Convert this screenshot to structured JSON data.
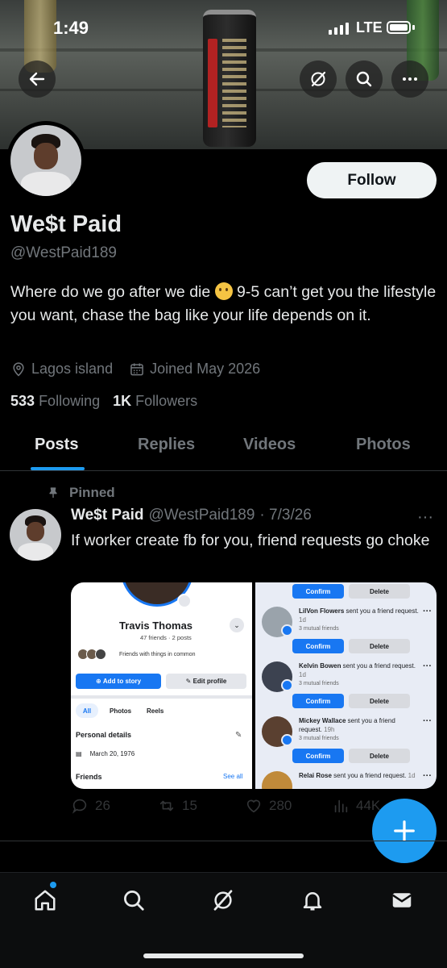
{
  "status_bar": {
    "time": "1:49",
    "network": "LTE"
  },
  "colors": {
    "accent": "#1d9bf0",
    "background": "#000000",
    "secondary_text": "#71767b"
  },
  "banner": {
    "back_icon": "arrow-left-icon",
    "grok_icon": "grok-icon",
    "search_icon": "search-icon",
    "more_icon": "more-icon"
  },
  "profile": {
    "follow_label": "Follow",
    "name": "We$t Paid",
    "handle": "@WestPaid189",
    "bio_before_emoji": "Where do we go after we die",
    "bio_after_emoji": " 9-5 can’t get you the lifestyle you want, chase the bag like your life depends on it.",
    "location": "Lagos island",
    "joined": "Joined May 2026",
    "following_count": "533",
    "following_label": "Following",
    "followers_count": "1K",
    "followers_label": "Followers"
  },
  "tabs": [
    {
      "label": "Posts",
      "active": true
    },
    {
      "label": "Replies",
      "active": false
    },
    {
      "label": "Videos",
      "active": false
    },
    {
      "label": "Photos",
      "active": false
    }
  ],
  "post": {
    "pinned_label": "Pinned",
    "author_name": "We$t Paid",
    "author_handle": "@WestPaid189",
    "date": "· 7/3/26",
    "text": "If worker create fb for you, friend requests go choke",
    "more": "···",
    "image_left": {
      "name": "Travis Thomas",
      "sub": "47 friends · 2 posts",
      "common": "Friends with things in common",
      "add_story": "Add to story",
      "edit_profile": "Edit profile",
      "pills": [
        "All",
        "Photos",
        "Reels"
      ],
      "section": "Personal details",
      "birthday": "March 20, 1976",
      "friends": "Friends",
      "see_all": "See all"
    },
    "image_right": {
      "confirm": "Confirm",
      "delete": "Delete",
      "requests": [
        {
          "name": "LilVon Flowers",
          "rest": " sent you a friend request.",
          "time": " 1d",
          "mutual": "3 mutual friends"
        },
        {
          "name": "Kelvin Bowen",
          "rest": " sent you a friend request.",
          "time": " 1d",
          "mutual": "3 mutual friends"
        },
        {
          "name": "Mickey Wallace",
          "rest": " sent you a friend request.",
          "time": " 19h",
          "mutual": "3 mutual friends"
        },
        {
          "name": "Relai Rose",
          "rest": " sent you a friend request.",
          "time": " 1d",
          "mutual": ""
        }
      ]
    },
    "actions": {
      "replies": "26",
      "reposts": "15",
      "likes": "280",
      "views": "44K"
    }
  },
  "bottom_nav": [
    "home-icon",
    "search-icon",
    "grok-icon",
    "notifications-icon",
    "messages-icon"
  ]
}
